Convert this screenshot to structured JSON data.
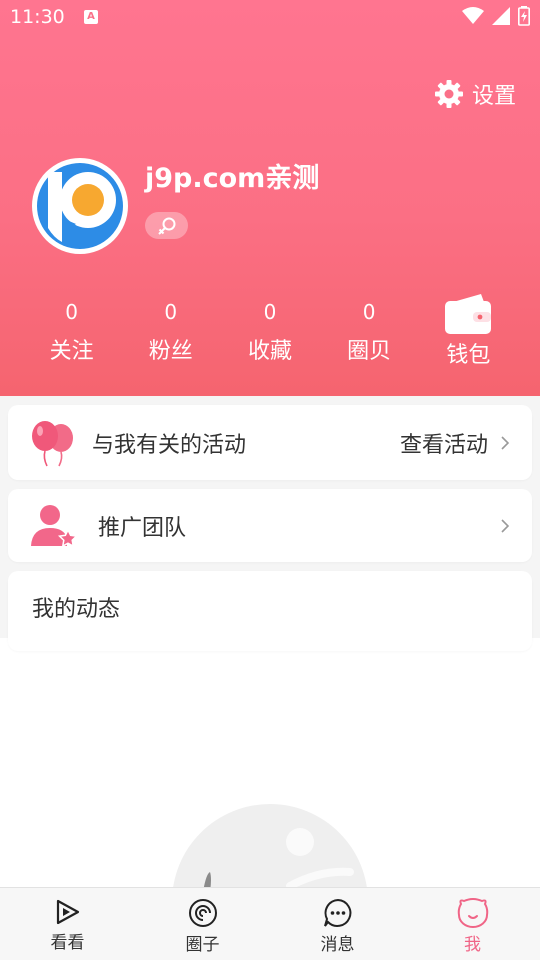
{
  "status_bar": {
    "time": "11:30",
    "app_icon_letter": "A"
  },
  "settings": {
    "label": "设置",
    "icon": "gear-icon"
  },
  "profile": {
    "username": "j9p.com亲测",
    "gender_icon": "female-icon",
    "avatar_icon": "p-logo-avatar"
  },
  "stats": [
    {
      "value": "0",
      "label": "关注"
    },
    {
      "value": "0",
      "label": "粉丝"
    },
    {
      "value": "0",
      "label": "收藏"
    },
    {
      "value": "0",
      "label": "圈贝"
    },
    {
      "label": "钱包",
      "icon": "wallet-icon"
    }
  ],
  "cards": {
    "activity": {
      "title": "与我有关的活动",
      "action": "查看活动",
      "icon": "balloons-icon"
    },
    "team": {
      "title": "推广团队",
      "icon": "team-user-star-icon"
    },
    "dynamics": {
      "title": "我的动态"
    }
  },
  "tabs": [
    {
      "label": "看看",
      "icon": "play-icon"
    },
    {
      "label": "圈子",
      "icon": "circle-spiral-icon"
    },
    {
      "label": "消息",
      "icon": "message-dots-icon"
    },
    {
      "label": "我",
      "icon": "face-icon",
      "active": true
    }
  ],
  "colors": {
    "accent": "#f06587",
    "header_top": "#ff7590",
    "header_bottom": "#f5646f"
  }
}
